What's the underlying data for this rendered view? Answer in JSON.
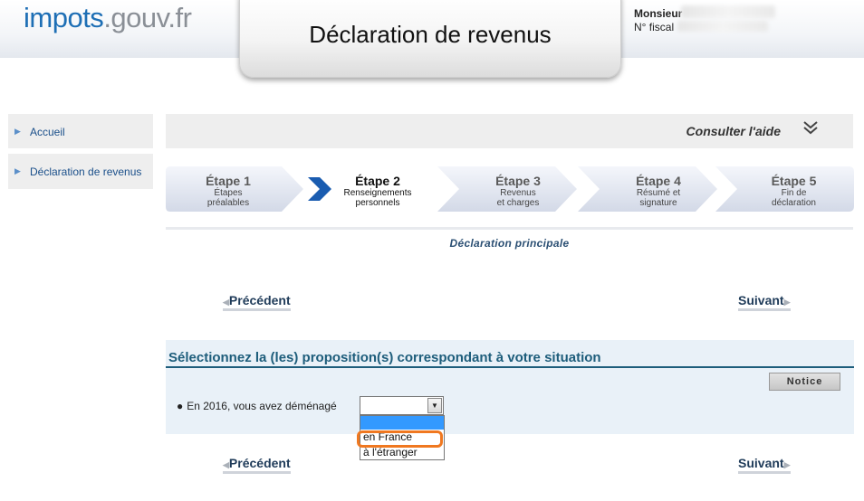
{
  "header": {
    "logo_part1": "impots",
    "logo_part2": ".gouv.fr",
    "title": "Déclaration de revenus",
    "user_title": "Monsieur",
    "fiscal_label": "N° fiscal"
  },
  "sidebar": {
    "items": [
      {
        "label": "Accueil"
      },
      {
        "label": "Déclaration de revenus"
      }
    ]
  },
  "helpbar": {
    "label": "Consulter l'aide"
  },
  "steps": [
    {
      "num": "Étape 1",
      "line1": "Étapes",
      "line2": "préalables"
    },
    {
      "num": "Étape 2",
      "line1": "Renseignements",
      "line2": "personnels"
    },
    {
      "num": "Étape 3",
      "line1": "Revenus",
      "line2": "et charges"
    },
    {
      "num": "Étape 4",
      "line1": "Résumé et",
      "line2": "signature"
    },
    {
      "num": "Étape 5",
      "line1": "Fin de",
      "line2": "déclaration"
    }
  ],
  "active_step": "Étape 2",
  "section": {
    "label": "Déclaration principale"
  },
  "nav": {
    "prev": "Précédent",
    "next": "Suivant"
  },
  "panel": {
    "title": "Sélectionnez la (les) proposition(s) correspondant à votre situation",
    "notice": "Notice",
    "question": "En 2016, vous avez déménagé"
  },
  "select": {
    "value": "",
    "options": [
      "",
      "en France",
      "à l'étranger"
    ]
  },
  "colors": {
    "brand_blue": "#1e6fb5",
    "active_chevron": "#1a5cb0",
    "panel_bg": "#e9f1f8",
    "highlight": "#f07820",
    "selected_option": "#3399ff"
  }
}
